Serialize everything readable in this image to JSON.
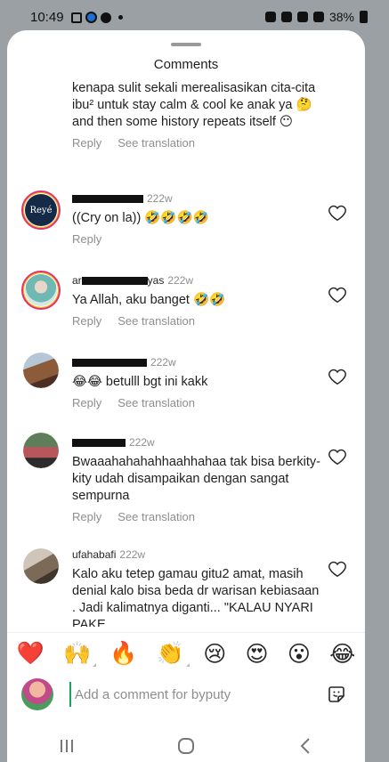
{
  "status_bar": {
    "time": "10:49",
    "battery": "38%"
  },
  "sheet": {
    "title": "Comments"
  },
  "comments": [
    {
      "username": "",
      "time": "",
      "text": "kenapa sulit sekali merealisasikan cita-cita ibu² untuk stay calm & cool ke anak ya 🤔 and then some history repeats itself 😶",
      "reply": "Reply",
      "translate": "See translation"
    },
    {
      "username": "",
      "time": "222w",
      "text": "((Cry on la)) 🤣🤣🤣🤣",
      "reply": "Reply",
      "translate": ""
    },
    {
      "username": "ar",
      "username_suffix": "yas",
      "time": "222w",
      "text": "Ya Allah, aku banget 🤣🤣",
      "reply": "Reply",
      "translate": "See translation"
    },
    {
      "username": "",
      "time": "222w",
      "text": "😂😂 betulll bgt ini kakk",
      "reply": "Reply",
      "translate": "See translation"
    },
    {
      "username": "",
      "time": "222w",
      "text": "Bwaaahahahahhaahhahaa tak bisa berkity-kity udah disampaikan dengan sangat sempurna",
      "reply": "Reply",
      "translate": "See translation"
    },
    {
      "username": "ufahabafi",
      "time": "222w",
      "text": "Kalo aku tetep gamau gitu2 amat, masih denial kalo bisa beda dr warisan kebiasaan . Jadi kalimatnya diganti... \"KALAU NYARI PAKE",
      "reply": "",
      "translate": ""
    }
  ],
  "reactions": [
    "❤️",
    "🙌",
    "🔥",
    "👏",
    "😢",
    "😍",
    "😮",
    "😂"
  ],
  "composer": {
    "placeholder": "Add a comment for byputy"
  },
  "icons": {
    "like": "heart-outline-icon",
    "sticker": "sticker-icon",
    "nav_recent": "recent-apps-icon",
    "nav_home": "home-icon",
    "nav_back": "back-icon"
  },
  "colors": {
    "accent": "#e1306c",
    "muted": "#8e8e8e",
    "caret": "#1aa260"
  }
}
